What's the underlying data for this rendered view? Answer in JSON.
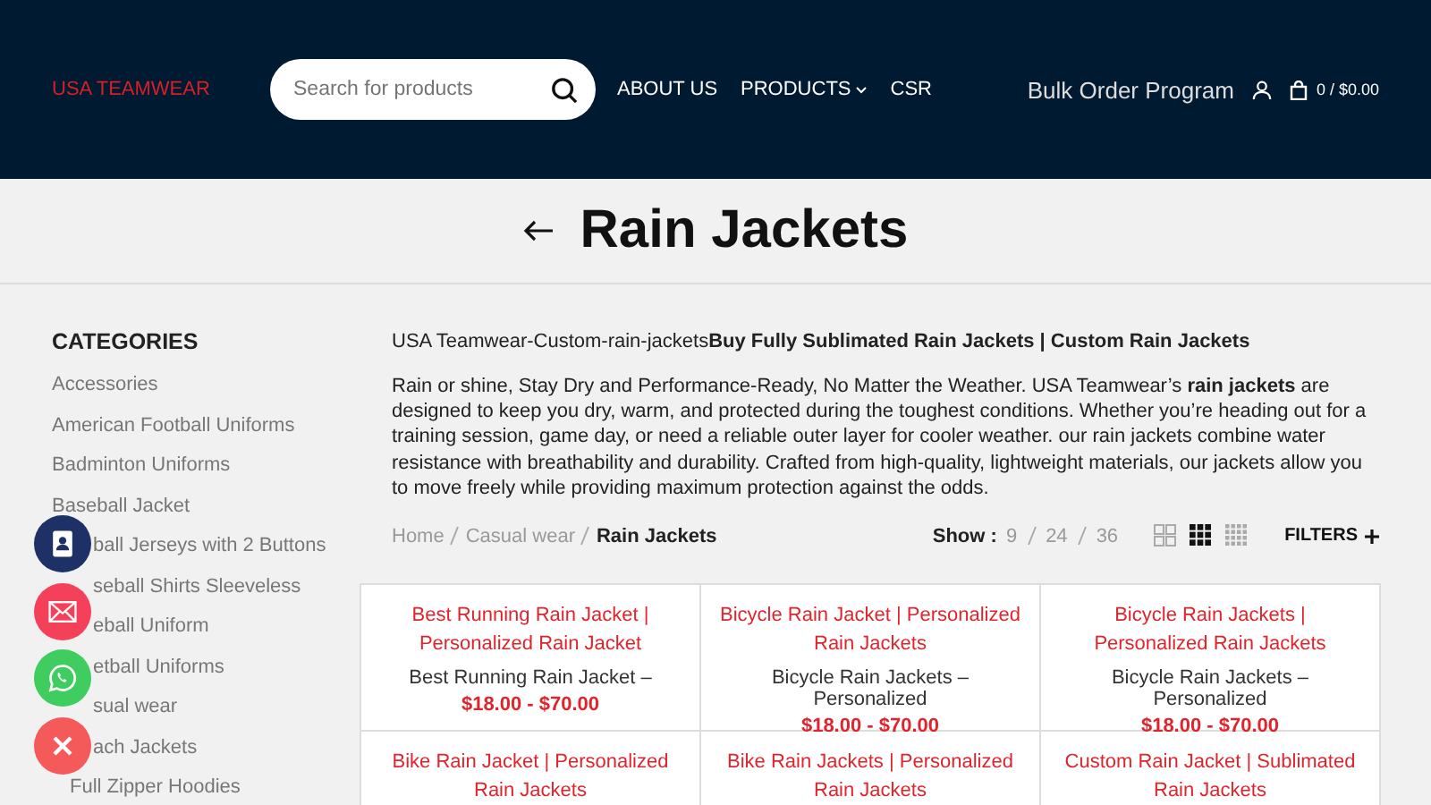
{
  "header": {
    "logo": "USA TEAMWEAR",
    "search": {
      "placeholder": "Search for products"
    },
    "nav": [
      {
        "label": "ABOUT US",
        "dropdown": false
      },
      {
        "label": "PRODUCTS",
        "dropdown": true
      },
      {
        "label": "CSR",
        "dropdown": false
      }
    ],
    "bulk": "Bulk Order Program",
    "cart": "0 / $0.00"
  },
  "page_title": "Rain Jackets",
  "sidebar": {
    "title": "CATEGORIES",
    "items": [
      {
        "label": "Accessories",
        "kind": "full"
      },
      {
        "label": "American Football Uniforms",
        "kind": "full"
      },
      {
        "label": "Badminton Uniforms",
        "kind": "full"
      },
      {
        "label": "Baseball Jacket",
        "kind": "full"
      },
      {
        "label": "ball Jerseys with 2 Buttons",
        "kind": "partial"
      },
      {
        "label": "seball Shirts Sleeveless",
        "kind": "partial"
      },
      {
        "label": "eball Uniform",
        "kind": "partial"
      },
      {
        "label": "etball Uniforms",
        "kind": "partial"
      },
      {
        "label": "sual wear",
        "kind": "partial"
      },
      {
        "label": "ach Jackets",
        "kind": "partial",
        "children": [
          {
            "label": "Full Zipper Hoodies"
          }
        ]
      }
    ]
  },
  "intro": {
    "lead": "USA Teamwear-Custom-rain-jackets",
    "heading": "Buy Fully Sublimated Rain Jackets | Custom Rain Jackets",
    "text": "Rain or shine, Stay Dry and Performance-Ready, No Matter the Weather. USA Teamwear’s **rain jackets** are designed to keep you dry, warm, and protected during the toughest conditions. Whether you’re heading out for a training session, game day, or need a reliable outer layer for cooler weather. our rain jackets combine water resistance with breathability and durability. Crafted from high-quality, lightweight materials, our jackets allow you to move freely while providing maximum protection against the odds."
  },
  "breadcrumb": [
    {
      "label": "Home",
      "current": false
    },
    {
      "label": "Casual wear",
      "current": false
    },
    {
      "label": "Rain Jackets",
      "current": true
    }
  ],
  "show": {
    "label": "Show :",
    "options": [
      {
        "label": "9",
        "selected": false
      },
      {
        "label": "24",
        "selected": false
      },
      {
        "label": "36",
        "selected": false
      }
    ]
  },
  "views": [
    {
      "kind": "grid2",
      "selected": false
    },
    {
      "kind": "grid3",
      "selected": true
    },
    {
      "kind": "grid4",
      "selected": false
    }
  ],
  "filters": "FILTERS",
  "products": [
    {
      "title": "Best Running Rain Jacket | Personalized Rain Jacket",
      "excerpt": "Best Running Rain Jacket –",
      "price": "$18.00 - $70.00"
    },
    {
      "title": "Bicycle Rain Jacket | Personalized Rain Jackets",
      "excerpt": "Bicycle Rain Jackets – Personalized",
      "price": "$18.00 - $70.00"
    },
    {
      "title": "Bicycle Rain Jackets | Personalized Rain Jackets",
      "excerpt": "Bicycle Rain Jackets – Personalized",
      "price": "$18.00 - $70.00"
    },
    {
      "title": "Bike Rain Jacket | Personalized Rain Jackets"
    },
    {
      "title": "Bike Rain Jackets | Personalized Rain Jackets"
    },
    {
      "title": "Custom Rain Jacket | Sublimated Rain Jackets"
    }
  ],
  "floating": [
    {
      "kind": "contact",
      "color": "#1d3166"
    },
    {
      "kind": "email",
      "color": "#f5405a"
    },
    {
      "kind": "whatsapp",
      "color": "#3ecd5e"
    },
    {
      "kind": "close",
      "color": "#f55a5a"
    }
  ]
}
